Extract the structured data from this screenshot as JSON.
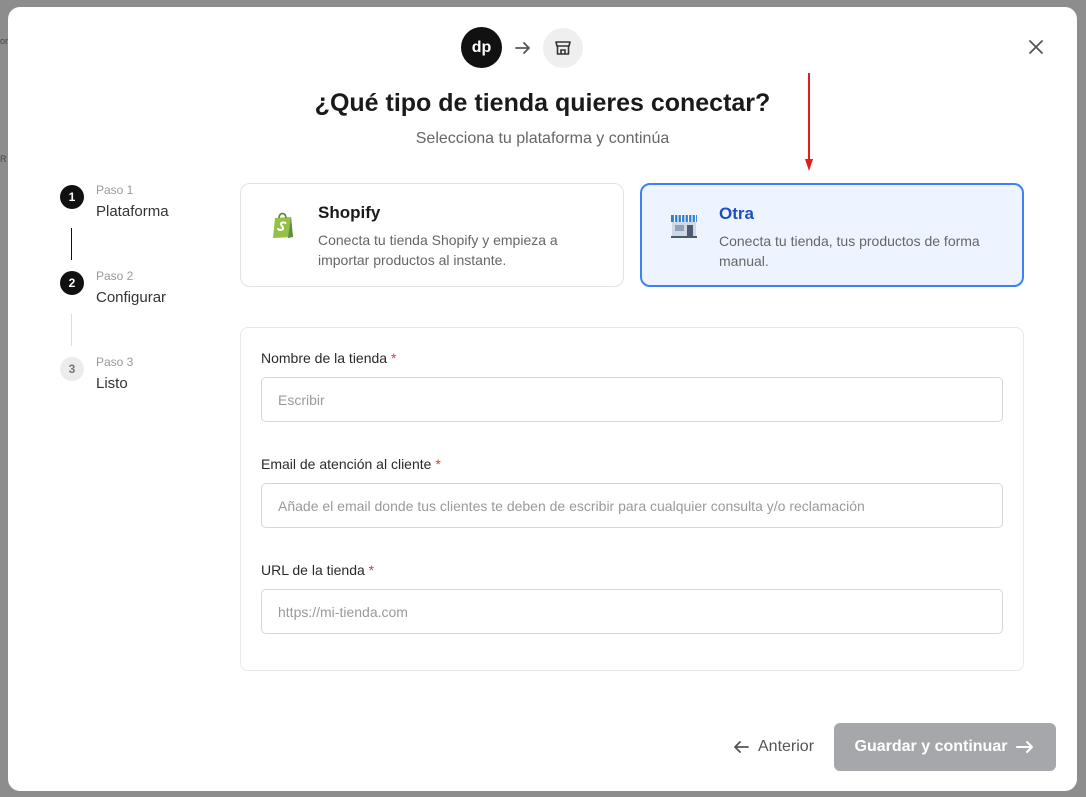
{
  "header": {
    "logo_text": "dp",
    "title": "¿Qué tipo de tienda quieres conectar?",
    "subtitle": "Selecciona tu plataforma y continúa"
  },
  "steps": [
    {
      "number": "1",
      "kicker": "Paso 1",
      "label": "Plataforma",
      "state": "done"
    },
    {
      "number": "2",
      "kicker": "Paso 2",
      "label": "Configurar",
      "state": "current"
    },
    {
      "number": "3",
      "kicker": "Paso 3",
      "label": "Listo",
      "state": "pending"
    }
  ],
  "platforms": [
    {
      "name": "Shopify",
      "description": "Conecta tu tienda Shopify y empieza a importar productos al instante.",
      "icon": "shopify-bag-icon",
      "selected": false
    },
    {
      "name": "Otra",
      "description": "Conecta tu tienda, tus productos de forma manual.",
      "icon": "storefront-icon",
      "selected": true
    }
  ],
  "form": {
    "store_name": {
      "label": "Nombre de la tienda",
      "required_mark": "*",
      "placeholder": "Escribir",
      "value": ""
    },
    "support_email": {
      "label": "Email de atención al cliente",
      "required_mark": "*",
      "placeholder": "Añade el email donde tus clientes te deben de escribir para cualquier consulta y/o reclamación",
      "value": ""
    },
    "store_url": {
      "label": "URL de la tienda",
      "required_mark": "*",
      "placeholder": "https://mi-tienda.com",
      "value": ""
    }
  },
  "footer": {
    "prev_label": "Anterior",
    "save_label": "Guardar y continuar"
  },
  "colors": {
    "accent": "#3b82f6",
    "selected_bg": "#eef4ff",
    "required": "#d43a3a",
    "disabled_button": "#a5a7aa",
    "annotation_arrow": "#e11d1d"
  }
}
